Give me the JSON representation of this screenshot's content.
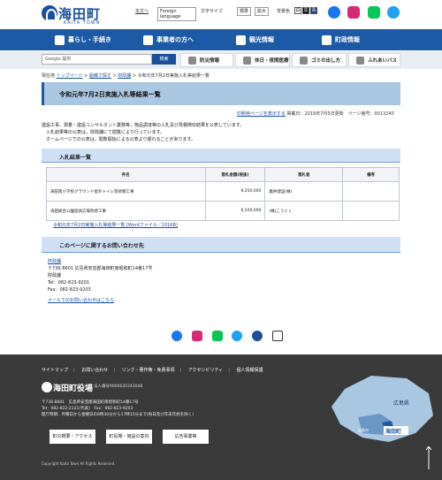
{
  "header": {
    "logo_text": "海田町",
    "logo_sub": "KAITA TOWN",
    "main_text_link": "本文へ",
    "language": "Foreign language",
    "font_size_label": "文字サイズ",
    "font_standard": "標準",
    "font_large": "拡大",
    "bg_color_label": "背景色"
  },
  "nav": [
    {
      "label": "暮らし・手続き",
      "icon": "family-icon"
    },
    {
      "label": "事業者の方へ",
      "icon": "building-icon"
    },
    {
      "label": "観光情報",
      "icon": "binoculars-icon"
    },
    {
      "label": "町政情報",
      "icon": "town-icon"
    }
  ],
  "search": {
    "placeholder": "Google 提供",
    "button": "検索"
  },
  "quick_links": [
    {
      "label": "防災情報"
    },
    {
      "label": "休日・夜間医療"
    },
    {
      "label": "ゴミの出し方"
    },
    {
      "label": "ふれあいバス"
    }
  ],
  "breadcrumb": {
    "home": "現在地",
    "top": "トップページ",
    "c1": "組織で探す",
    "c2": "財政課",
    "current": "令和元年7月2日実施入札等結果一覧"
  },
  "page": {
    "title": "令和元年7月2日実施入札等結果一覧",
    "print_link": "印刷用ページを表示する",
    "updated": "掲載日：2019年7月5日更新　ページ番号：0013240",
    "body": [
      "建設工事，測量・建設コンサルタント業務等，物品調達等の入札及び見積徴収結果を公表しています。",
      "　入札結果等の公表は，財政課にて閲覧により行っています。",
      "　ホームページでの公表は，閲覧開始による公表より遅れることがあります。"
    ]
  },
  "results": {
    "section_title": "入札結果一覧",
    "headers": [
      "件名",
      "落札金額(税抜)",
      "落札者",
      "備考"
    ],
    "rows": [
      {
        "name": "海田南小学校グラウンド屋外トイレ等修繕工事",
        "amount": "9,250,000",
        "winner": "廣井建設(株)",
        "note": ""
      },
      {
        "name": "海田総合公園遊具広場改修工事",
        "amount": "6,500,000",
        "winner": "(株)こうぐく",
        "note": ""
      }
    ],
    "word_link": "令和元年7月2日実施入札等結果一覧 [Wordファイル／101KB]"
  },
  "contact": {
    "section_title": "このページに関するお問い合わせ先",
    "dept": "財政課",
    "address": "〒736-8601 広島県安芸郡海田町南昭和町14番17号",
    "dept2": "財政課",
    "tel": "Tel：082-823-9201",
    "fax": "Fax：082-823-9203",
    "mail": "メールでのお問い合わせはこちら"
  },
  "footer": {
    "links": [
      "サイトマップ",
      "お問い合わせ",
      "リンク・著作権・免責事項",
      "アクセシビリティ",
      "個人情報保護"
    ],
    "name": "海田町役場",
    "corp_no": "法人番号9000020343048",
    "address": "〒736-8601　広島県安芸郡海田町南昭和町14番17号",
    "tel": "Tel：082-822-2121(代表)　Fax：082-823-9203",
    "hours": "開庁時間：月曜日から金曜日の8時30分から17時15分まで(祝日及び年末年始を除く)",
    "buttons": [
      "町の概要・アクセス",
      "町役場・施設の案内",
      "広告事業等"
    ],
    "map_pref": "広島県",
    "map_town": "海田町",
    "map_city": "広島市",
    "copyright": "Copyright Kaita Town All Rights Reserved."
  },
  "colors": {
    "brand": "#1d5aa5",
    "title_bg": "#a9c7e0",
    "footer_bg": "#3a3a3a"
  }
}
